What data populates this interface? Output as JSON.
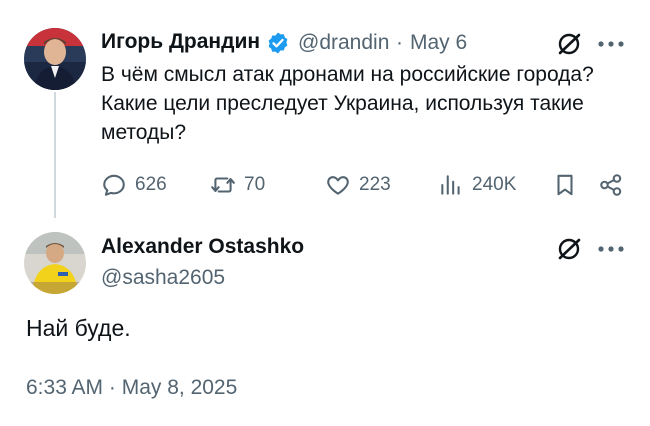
{
  "colors": {
    "text_primary": "#0f1419",
    "text_secondary": "#536471",
    "verified_blue": "#1d9bf0",
    "thread_line": "#cfd9de"
  },
  "tweet": {
    "author_name": "Игорь Драндин",
    "verified": true,
    "handle": "@drandin",
    "separator": "·",
    "date": "May 6",
    "text_lines": [
      "В чём смысл атак дронами на российские города?",
      "Какие цели преследует Украина, используя такие",
      "методы?"
    ],
    "actions": {
      "replies": "626",
      "reposts": "70",
      "likes": "223",
      "views": "240K"
    },
    "icons": [
      "grok-icon",
      "more-icon",
      "reply-icon",
      "repost-icon",
      "like-icon",
      "views-icon",
      "bookmark-icon",
      "share-icon"
    ]
  },
  "reply": {
    "author_name": "Alexander Ostashko",
    "handle": "@sasha2605",
    "text": "Най буде.",
    "timestamp": "6:33 AM · May 8, 2025",
    "icons": [
      "grok-icon",
      "more-icon"
    ]
  }
}
